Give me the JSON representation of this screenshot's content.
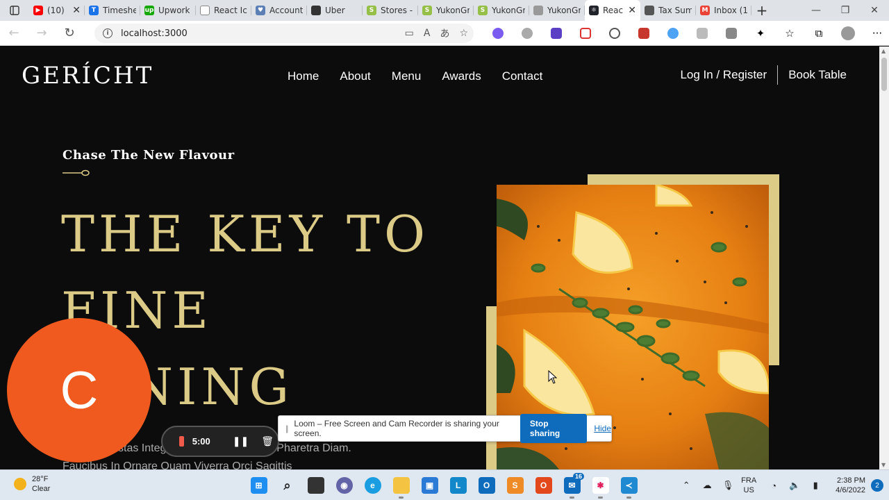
{
  "browser": {
    "tabs": [
      {
        "title": "(10)",
        "icon": "youtube-icon",
        "color": "#ff0000",
        "glyph": "▶",
        "width": 80
      },
      {
        "title": "Timeshe",
        "icon": "timeshee-icon",
        "color": "#1a73e8",
        "glyph": "T",
        "width": 80
      },
      {
        "title": "Upwork",
        "icon": "upwork-icon",
        "color": "#14a800",
        "glyph": "up",
        "width": 80
      },
      {
        "title": "React Ico",
        "icon": "page-icon",
        "color": "#ffffff",
        "glyph": "",
        "width": 80
      },
      {
        "title": "Account",
        "icon": "shield-icon",
        "color": "#5b7fb5",
        "glyph": "♥",
        "width": 80
      },
      {
        "title": "Uber",
        "icon": "uber-icon",
        "color": "#333333",
        "glyph": "",
        "width": 80
      },
      {
        "title": "Stores - S",
        "icon": "shopify-icon",
        "color": "#95bf47",
        "glyph": "S",
        "width": 80
      },
      {
        "title": "YukonGr",
        "icon": "shopify-icon",
        "color": "#95bf47",
        "glyph": "S",
        "width": 80
      },
      {
        "title": "YukonGr",
        "icon": "shopify-icon",
        "color": "#95bf47",
        "glyph": "S",
        "width": 80
      },
      {
        "title": "YukonGr",
        "icon": "page-icon",
        "color": "#999999",
        "glyph": "",
        "width": 80
      },
      {
        "title": "Reac",
        "icon": "react-icon",
        "color": "#20232a",
        "glyph": "⚛",
        "width": 80,
        "active": true
      },
      {
        "title": "Tax Sum",
        "icon": "page-icon",
        "color": "#555555",
        "glyph": "",
        "width": 80
      },
      {
        "title": "Inbox (1",
        "icon": "gmail-icon",
        "color": "#ea4335",
        "glyph": "M",
        "width": 80
      }
    ],
    "address": "localhost:3000"
  },
  "site": {
    "logo": "GERÍCHT",
    "nav": [
      "Home",
      "About",
      "Menu",
      "Awards",
      "Contact"
    ],
    "login": "Log In / Register",
    "book": "Book Table",
    "subheading": "Chase The New Flavour",
    "title_lines": [
      "THE KEY TO",
      "FINE",
      "NING"
    ],
    "body_lines": [
      "stas Integ",
      "Nulla Pharetra Diam.",
      "Faucibus In Ornare Quam Viverra Orci Sagittis"
    ],
    "accent_color": "#dcca87"
  },
  "loom": {
    "message": "Loom – Free Screen and Cam Recorder is sharing your screen.",
    "stop_label": "Stop sharing",
    "hide_label": "Hide",
    "cam_initial": "C",
    "timer": "5:00"
  },
  "taskbar": {
    "weather_temp": "28°F",
    "weather_desc": "Clear",
    "lang_top": "FRA",
    "lang_bottom": "US",
    "time": "2:38 PM",
    "date": "4/6/2022",
    "notifications": "2",
    "mail_badge": "16"
  }
}
